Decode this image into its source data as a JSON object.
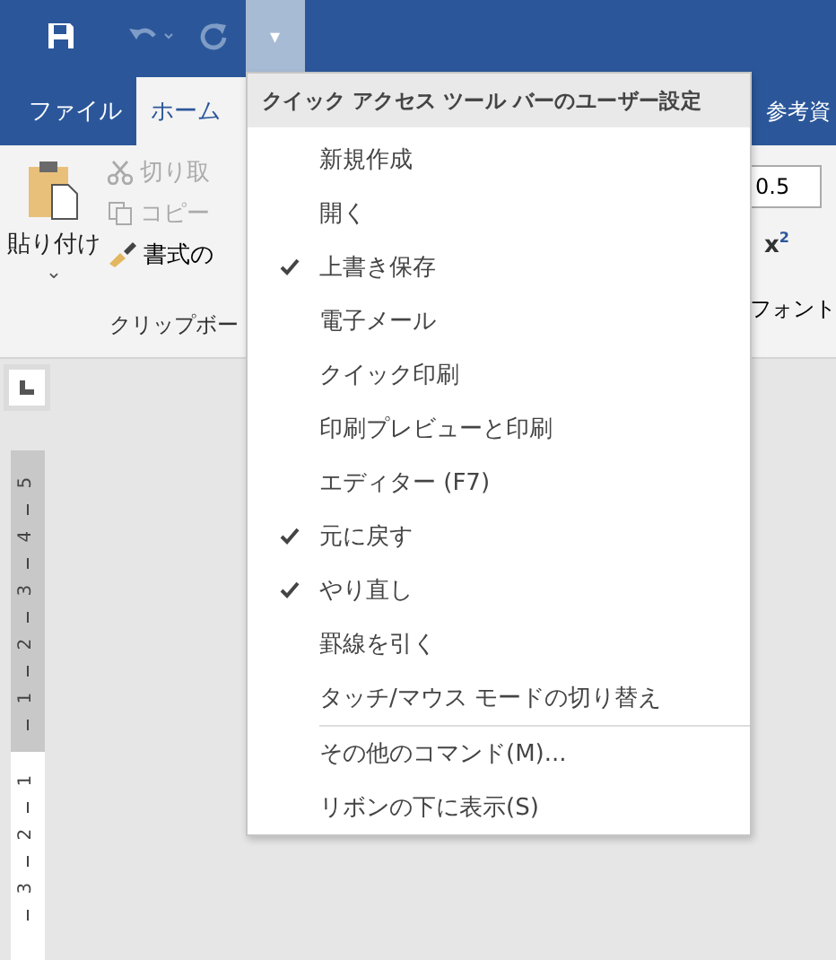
{
  "quick_access_toolbar": {
    "menu_button": "▾"
  },
  "tabs": [
    {
      "label": "ファイル",
      "selected": false
    },
    {
      "label": "ホーム",
      "selected": true
    },
    {
      "label": "参考資",
      "selected": false
    }
  ],
  "ribbon": {
    "paste_label": "貼り付け",
    "paste_caret": "⌄",
    "cut": "切り取",
    "copy": "コピー",
    "format_painter": "書式の",
    "clipboard_group": "クリップボー",
    "font_size": "0.5",
    "superscript": "x",
    "superscript_mark": "2",
    "font_group": "フォント"
  },
  "ruler": {
    "gray_marks": [
      "5",
      "4",
      "3",
      "2",
      "1"
    ],
    "white_marks": [
      "1",
      "2",
      "3"
    ]
  },
  "menu": {
    "title": "クイック アクセス ツール バーのユーザー設定",
    "items": [
      {
        "label": "新規作成",
        "checked": false
      },
      {
        "label": "開く",
        "checked": false
      },
      {
        "label": "上書き保存",
        "checked": true
      },
      {
        "label": "電子メール",
        "checked": false
      },
      {
        "label": "クイック印刷",
        "checked": false
      },
      {
        "label": "印刷プレビューと印刷",
        "checked": false
      },
      {
        "label": "エディター (F7)",
        "checked": false
      },
      {
        "label": "元に戻す",
        "checked": true
      },
      {
        "label": "やり直し",
        "checked": true
      },
      {
        "label": "罫線を引く",
        "checked": false
      },
      {
        "label": "タッチ/マウス モードの切り替え",
        "checked": false
      }
    ],
    "footer_items": [
      {
        "label": "その他のコマンド(M)..."
      },
      {
        "label": "リボンの下に表示(S)"
      }
    ]
  }
}
